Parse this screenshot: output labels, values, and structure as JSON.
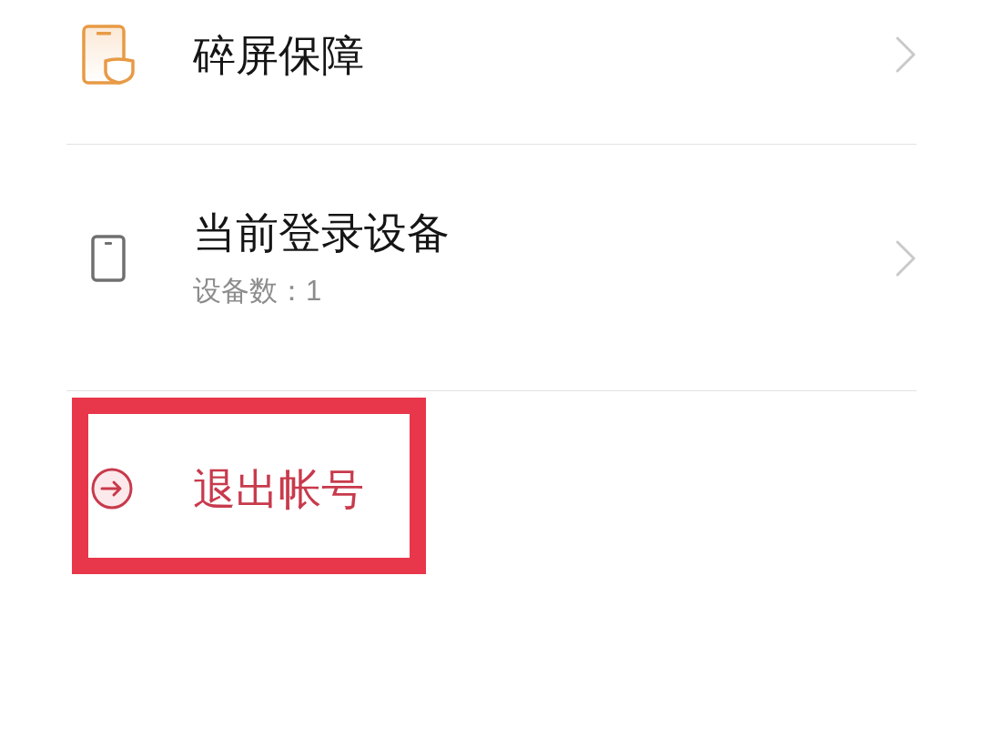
{
  "menu_items": [
    {
      "kind": "link",
      "title": "碎屏保障"
    },
    {
      "kind": "link",
      "title": "当前登录设备",
      "subtitle": "设备数：1"
    },
    {
      "kind": "action",
      "title": "退出帐号",
      "highlighted": true
    }
  ]
}
